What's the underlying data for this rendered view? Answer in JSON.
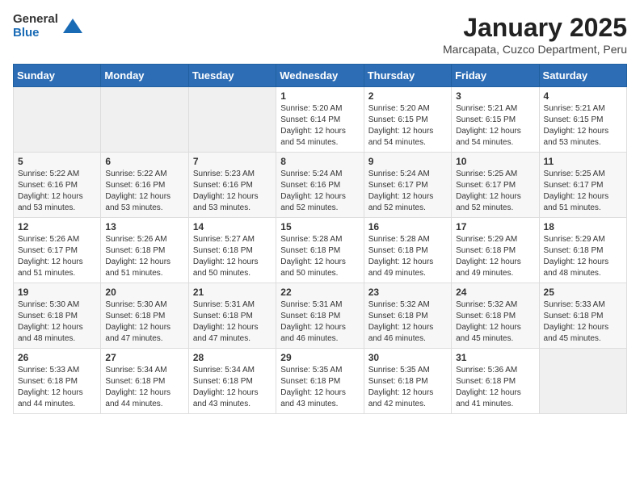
{
  "logo": {
    "general": "General",
    "blue": "Blue"
  },
  "header": {
    "month": "January 2025",
    "location": "Marcapata, Cuzco Department, Peru"
  },
  "weekdays": [
    "Sunday",
    "Monday",
    "Tuesday",
    "Wednesday",
    "Thursday",
    "Friday",
    "Saturday"
  ],
  "weeks": [
    [
      {
        "day": "",
        "info": ""
      },
      {
        "day": "",
        "info": ""
      },
      {
        "day": "",
        "info": ""
      },
      {
        "day": "1",
        "sunrise": "Sunrise: 5:20 AM",
        "sunset": "Sunset: 6:14 PM",
        "daylight": "Daylight: 12 hours and 54 minutes."
      },
      {
        "day": "2",
        "sunrise": "Sunrise: 5:20 AM",
        "sunset": "Sunset: 6:15 PM",
        "daylight": "Daylight: 12 hours and 54 minutes."
      },
      {
        "day": "3",
        "sunrise": "Sunrise: 5:21 AM",
        "sunset": "Sunset: 6:15 PM",
        "daylight": "Daylight: 12 hours and 54 minutes."
      },
      {
        "day": "4",
        "sunrise": "Sunrise: 5:21 AM",
        "sunset": "Sunset: 6:15 PM",
        "daylight": "Daylight: 12 hours and 53 minutes."
      }
    ],
    [
      {
        "day": "5",
        "sunrise": "Sunrise: 5:22 AM",
        "sunset": "Sunset: 6:16 PM",
        "daylight": "Daylight: 12 hours and 53 minutes."
      },
      {
        "day": "6",
        "sunrise": "Sunrise: 5:22 AM",
        "sunset": "Sunset: 6:16 PM",
        "daylight": "Daylight: 12 hours and 53 minutes."
      },
      {
        "day": "7",
        "sunrise": "Sunrise: 5:23 AM",
        "sunset": "Sunset: 6:16 PM",
        "daylight": "Daylight: 12 hours and 53 minutes."
      },
      {
        "day": "8",
        "sunrise": "Sunrise: 5:24 AM",
        "sunset": "Sunset: 6:16 PM",
        "daylight": "Daylight: 12 hours and 52 minutes."
      },
      {
        "day": "9",
        "sunrise": "Sunrise: 5:24 AM",
        "sunset": "Sunset: 6:17 PM",
        "daylight": "Daylight: 12 hours and 52 minutes."
      },
      {
        "day": "10",
        "sunrise": "Sunrise: 5:25 AM",
        "sunset": "Sunset: 6:17 PM",
        "daylight": "Daylight: 12 hours and 52 minutes."
      },
      {
        "day": "11",
        "sunrise": "Sunrise: 5:25 AM",
        "sunset": "Sunset: 6:17 PM",
        "daylight": "Daylight: 12 hours and 51 minutes."
      }
    ],
    [
      {
        "day": "12",
        "sunrise": "Sunrise: 5:26 AM",
        "sunset": "Sunset: 6:17 PM",
        "daylight": "Daylight: 12 hours and 51 minutes."
      },
      {
        "day": "13",
        "sunrise": "Sunrise: 5:26 AM",
        "sunset": "Sunset: 6:18 PM",
        "daylight": "Daylight: 12 hours and 51 minutes."
      },
      {
        "day": "14",
        "sunrise": "Sunrise: 5:27 AM",
        "sunset": "Sunset: 6:18 PM",
        "daylight": "Daylight: 12 hours and 50 minutes."
      },
      {
        "day": "15",
        "sunrise": "Sunrise: 5:28 AM",
        "sunset": "Sunset: 6:18 PM",
        "daylight": "Daylight: 12 hours and 50 minutes."
      },
      {
        "day": "16",
        "sunrise": "Sunrise: 5:28 AM",
        "sunset": "Sunset: 6:18 PM",
        "daylight": "Daylight: 12 hours and 49 minutes."
      },
      {
        "day": "17",
        "sunrise": "Sunrise: 5:29 AM",
        "sunset": "Sunset: 6:18 PM",
        "daylight": "Daylight: 12 hours and 49 minutes."
      },
      {
        "day": "18",
        "sunrise": "Sunrise: 5:29 AM",
        "sunset": "Sunset: 6:18 PM",
        "daylight": "Daylight: 12 hours and 48 minutes."
      }
    ],
    [
      {
        "day": "19",
        "sunrise": "Sunrise: 5:30 AM",
        "sunset": "Sunset: 6:18 PM",
        "daylight": "Daylight: 12 hours and 48 minutes."
      },
      {
        "day": "20",
        "sunrise": "Sunrise: 5:30 AM",
        "sunset": "Sunset: 6:18 PM",
        "daylight": "Daylight: 12 hours and 47 minutes."
      },
      {
        "day": "21",
        "sunrise": "Sunrise: 5:31 AM",
        "sunset": "Sunset: 6:18 PM",
        "daylight": "Daylight: 12 hours and 47 minutes."
      },
      {
        "day": "22",
        "sunrise": "Sunrise: 5:31 AM",
        "sunset": "Sunset: 6:18 PM",
        "daylight": "Daylight: 12 hours and 46 minutes."
      },
      {
        "day": "23",
        "sunrise": "Sunrise: 5:32 AM",
        "sunset": "Sunset: 6:18 PM",
        "daylight": "Daylight: 12 hours and 46 minutes."
      },
      {
        "day": "24",
        "sunrise": "Sunrise: 5:32 AM",
        "sunset": "Sunset: 6:18 PM",
        "daylight": "Daylight: 12 hours and 45 minutes."
      },
      {
        "day": "25",
        "sunrise": "Sunrise: 5:33 AM",
        "sunset": "Sunset: 6:18 PM",
        "daylight": "Daylight: 12 hours and 45 minutes."
      }
    ],
    [
      {
        "day": "26",
        "sunrise": "Sunrise: 5:33 AM",
        "sunset": "Sunset: 6:18 PM",
        "daylight": "Daylight: 12 hours and 44 minutes."
      },
      {
        "day": "27",
        "sunrise": "Sunrise: 5:34 AM",
        "sunset": "Sunset: 6:18 PM",
        "daylight": "Daylight: 12 hours and 44 minutes."
      },
      {
        "day": "28",
        "sunrise": "Sunrise: 5:34 AM",
        "sunset": "Sunset: 6:18 PM",
        "daylight": "Daylight: 12 hours and 43 minutes."
      },
      {
        "day": "29",
        "sunrise": "Sunrise: 5:35 AM",
        "sunset": "Sunset: 6:18 PM",
        "daylight": "Daylight: 12 hours and 43 minutes."
      },
      {
        "day": "30",
        "sunrise": "Sunrise: 5:35 AM",
        "sunset": "Sunset: 6:18 PM",
        "daylight": "Daylight: 12 hours and 42 minutes."
      },
      {
        "day": "31",
        "sunrise": "Sunrise: 5:36 AM",
        "sunset": "Sunset: 6:18 PM",
        "daylight": "Daylight: 12 hours and 41 minutes."
      },
      {
        "day": "",
        "info": ""
      }
    ]
  ]
}
